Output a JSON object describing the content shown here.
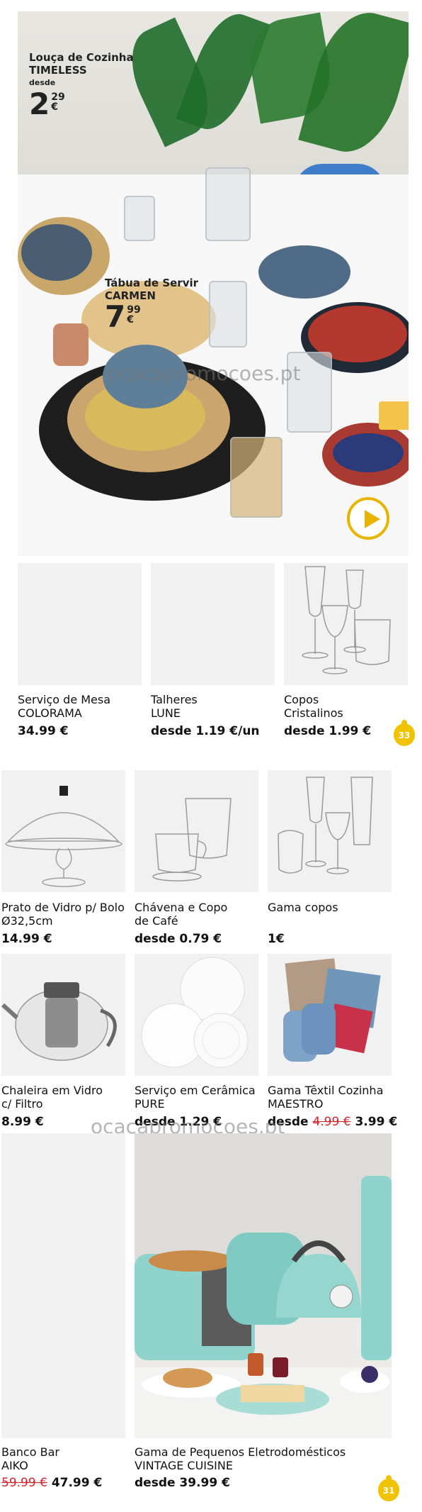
{
  "hero": {
    "product1": {
      "line1": "Louça de Cozinha",
      "line2": "TIMELESS",
      "prefix": "desde",
      "price_int": "2",
      "price_cents": "29",
      "currency": "€"
    },
    "product2": {
      "line1": "Tábua de Servir",
      "line2": "CARMEN",
      "price_int": "7",
      "price_cents": "99",
      "currency": "€"
    },
    "play_icon": "play-icon"
  },
  "watermark": "ocacapromocoes.pt",
  "row1": [
    {
      "name_l1": "Serviço de Mesa",
      "name_l2": "COLORAMA",
      "price": "34.99 €"
    },
    {
      "name_l1": "Talheres",
      "name_l2": "LUNE",
      "price": "desde 1.19 €/un"
    },
    {
      "name_l1": "Copos",
      "name_l2": "Cristalinos",
      "price": "desde 1.99 €"
    }
  ],
  "page_badge_1": "33",
  "row2": [
    {
      "name_l1": "Prato de Vidro p/ Bolo",
      "name_l2": "Ø32,5cm",
      "price": "14.99 €"
    },
    {
      "name_l1": "Chávena e Copo",
      "name_l2": "de Café",
      "price": "desde 0.79 €"
    },
    {
      "name_l1": "Gama copos",
      "name_l2": "",
      "price": "1€"
    }
  ],
  "row3": [
    {
      "name_l1": "Chaleira em Vidro",
      "name_l2": "c/ Filtro",
      "price": "8.99 €"
    },
    {
      "name_l1": "Serviço em Cerâmica",
      "name_l2": "PURE",
      "price": "desde 1.29 €"
    },
    {
      "name_l1": "Gama Têxtil Cozinha",
      "name_l2": "MAESTRO",
      "price_prefix": "desde",
      "old_price": "4.99 €",
      "price": "3.99 €"
    }
  ],
  "row4": [
    {
      "name_l1": "Banco Bar",
      "name_l2": "AIKO",
      "old_price": "59.99 €",
      "price": "47.99 €"
    },
    {
      "name_l1": "Gama de Pequenos Eletrodomésticos",
      "name_l2": "VINTAGE CUISINE",
      "price": "desde 39.99 €"
    }
  ],
  "page_badge_2": "31",
  "colors": {
    "accent_yellow": "#f1c200",
    "strike_red": "#d6202a",
    "tile_gray": "#f1f1f1"
  }
}
